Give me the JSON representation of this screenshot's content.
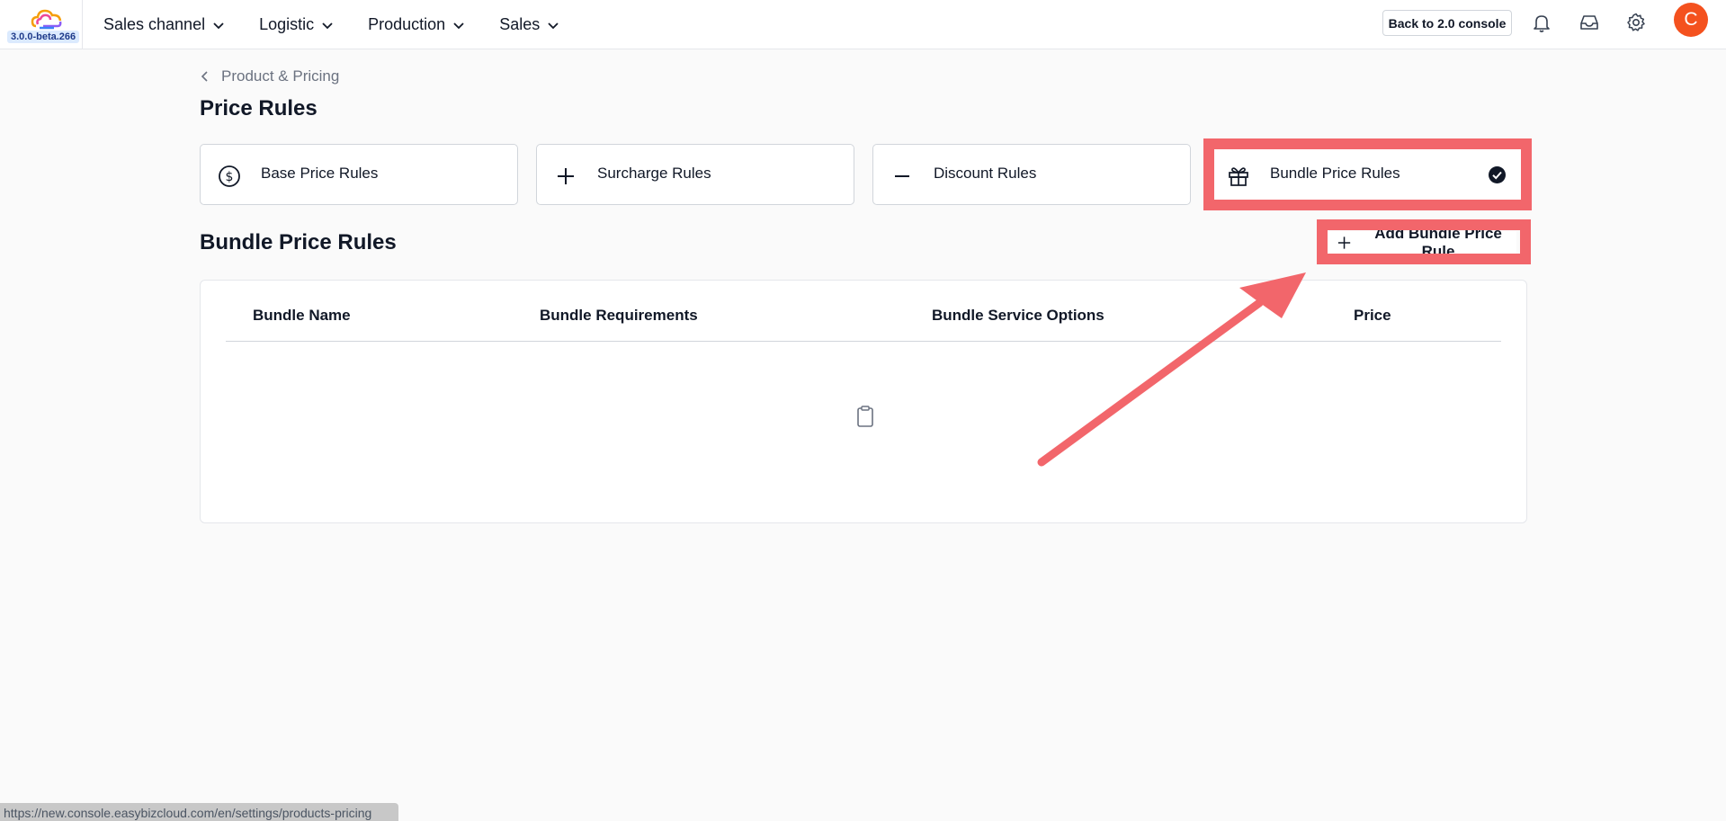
{
  "app": {
    "version": "3.0.0-beta.266",
    "logo_icon": "cloud-logo-icon"
  },
  "nav": {
    "items": [
      {
        "label": "Sales channel"
      },
      {
        "label": "Logistic"
      },
      {
        "label": "Production"
      },
      {
        "label": "Sales"
      }
    ]
  },
  "toolbar": {
    "back_label": "Back to 2.0 console",
    "icons": [
      "bell-icon",
      "inbox-icon",
      "gear-icon"
    ],
    "avatar_initial": "C",
    "avatar_color": "#f4511e"
  },
  "breadcrumb": {
    "label": "Product & Pricing"
  },
  "page": {
    "title": "Price Rules"
  },
  "rule_tabs": [
    {
      "label": "Base Price Rules",
      "icon": "dollar-circle-icon"
    },
    {
      "label": "Surcharge Rules",
      "icon": "plus-icon"
    },
    {
      "label": "Discount Rules",
      "icon": "minus-icon"
    },
    {
      "label": "Bundle Price Rules",
      "icon": "gift-icon",
      "selected": true
    }
  ],
  "section": {
    "title": "Bundle Price Rules",
    "add_label": "Add Bundle Price Rule"
  },
  "table": {
    "columns": [
      "Bundle Name",
      "Bundle Requirements",
      "Bundle Service Options",
      "Price"
    ],
    "rows": [],
    "empty_icon": "clipboard-icon"
  },
  "annotation": {
    "highlight_color": "#f2666b"
  },
  "status_bar": {
    "url": "https://new.console.easybizcloud.com/en/settings/products-pricing"
  }
}
